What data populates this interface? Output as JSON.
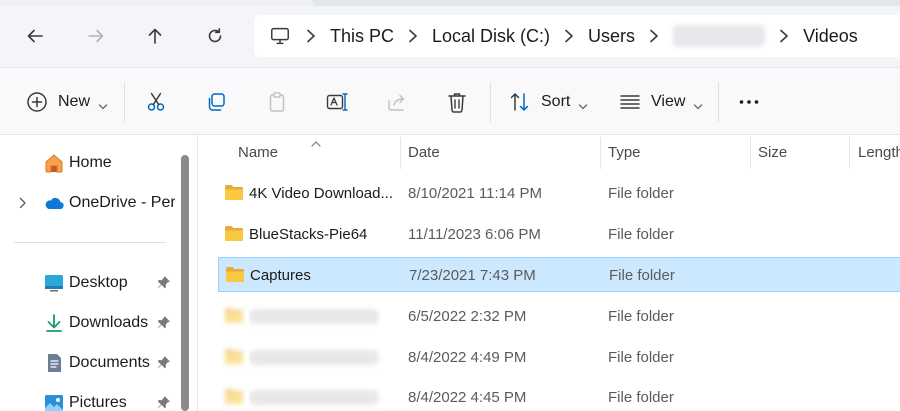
{
  "address_bar": {
    "breadcrumbs": [
      {
        "label": "This PC"
      },
      {
        "label": "Local Disk (C:)"
      },
      {
        "label": "Users"
      },
      {
        "label": ""
      },
      {
        "label": "Videos"
      }
    ]
  },
  "command_bar": {
    "new_label": "New",
    "sort_label": "Sort",
    "view_label": "View"
  },
  "sidebar": {
    "items": [
      {
        "label": "Home",
        "icon": "home-icon"
      },
      {
        "label": "OneDrive - Perso",
        "icon": "cloud-icon"
      },
      {
        "label": "Desktop",
        "icon": "desktop-icon",
        "pinned": true
      },
      {
        "label": "Downloads",
        "icon": "download-icon",
        "pinned": true
      },
      {
        "label": "Documents",
        "icon": "document-icon",
        "pinned": true
      },
      {
        "label": "Pictures",
        "icon": "pictures-icon",
        "pinned": true
      }
    ]
  },
  "file_list": {
    "columns": {
      "name": "Name",
      "date": "Date",
      "type": "Type",
      "size": "Size",
      "length": "Length"
    },
    "rows": [
      {
        "name": "4K Video Download...",
        "date": "8/10/2021 11:14 PM",
        "type": "File folder",
        "selected": false
      },
      {
        "name": "BlueStacks-Pie64",
        "date": "11/11/2023 6:06 PM",
        "type": "File folder",
        "selected": false
      },
      {
        "name": "Captures",
        "date": "7/23/2021 7:43 PM",
        "type": "File folder",
        "selected": true
      },
      {
        "name": "",
        "date": "6/5/2022 2:32 PM",
        "type": "File folder",
        "selected": false
      },
      {
        "name": "",
        "date": "8/4/2022 4:49 PM",
        "type": "File folder",
        "selected": false
      },
      {
        "name": "",
        "date": "8/4/2022 4:45 PM",
        "type": "File folder",
        "selected": false
      }
    ]
  },
  "colors": {
    "selection_bg": "#cce8ff",
    "selection_border": "#99d1ff",
    "folder": "#f8c941",
    "accent": "#0067c0"
  }
}
